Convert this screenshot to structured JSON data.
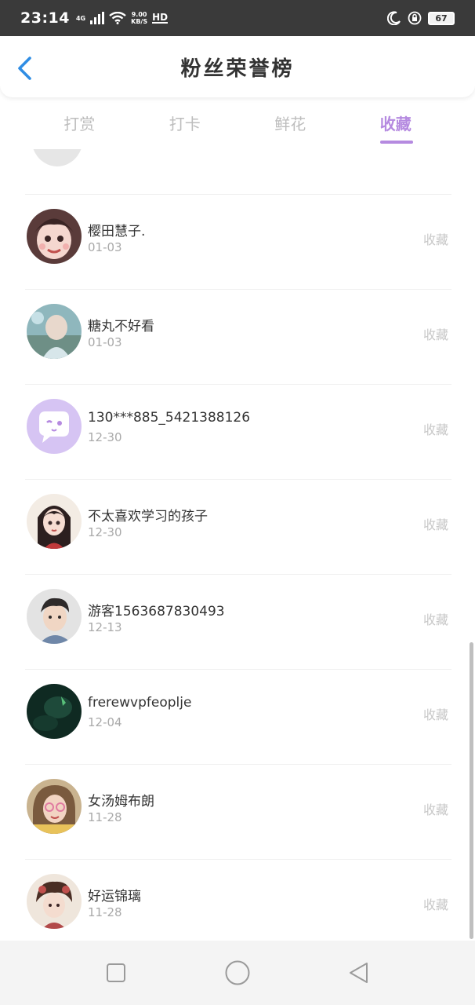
{
  "status_bar": {
    "time": "23:14",
    "network": "4G",
    "speed_value": "9.00",
    "speed_unit": "KB/S",
    "hd": "HD",
    "battery": "67"
  },
  "header": {
    "title": "粉丝荣誉榜"
  },
  "tabs": [
    {
      "label": "打赏",
      "active": false
    },
    {
      "label": "打卡",
      "active": false
    },
    {
      "label": "鲜花",
      "active": false
    },
    {
      "label": "收藏",
      "active": true
    }
  ],
  "colors": {
    "accent": "#b58ae0",
    "back_arrow": "#2f8de4"
  },
  "list": {
    "items": [
      {
        "name": "樱田慧子.",
        "date": "01-03",
        "action": "收藏",
        "avatar": "anime-girl-avatar"
      },
      {
        "name": "糖丸不好看",
        "date": "01-03",
        "action": "收藏",
        "avatar": "photo-avatar"
      },
      {
        "name": "130***885_5421388126",
        "date": "12-30",
        "action": "收藏",
        "avatar": "chat-bubble-avatar"
      },
      {
        "name": "不太喜欢学习的孩子",
        "date": "12-30",
        "action": "收藏",
        "avatar": "girl-illustration-avatar"
      },
      {
        "name": "游客1563687830493",
        "date": "12-13",
        "action": "收藏",
        "avatar": "boy-illustration-avatar"
      },
      {
        "name": "frerewvpfeoplje",
        "date": "12-04",
        "action": "收藏",
        "avatar": "dark-green-avatar"
      },
      {
        "name": "女汤姆布朗",
        "date": "11-28",
        "action": "收藏",
        "avatar": "girl-photo-avatar"
      },
      {
        "name": "好运锦璃",
        "date": "11-28",
        "action": "收藏",
        "avatar": "costume-girl-avatar"
      }
    ]
  },
  "navbar": {
    "buttons": [
      "recent-apps-icon",
      "home-icon",
      "back-icon"
    ]
  }
}
